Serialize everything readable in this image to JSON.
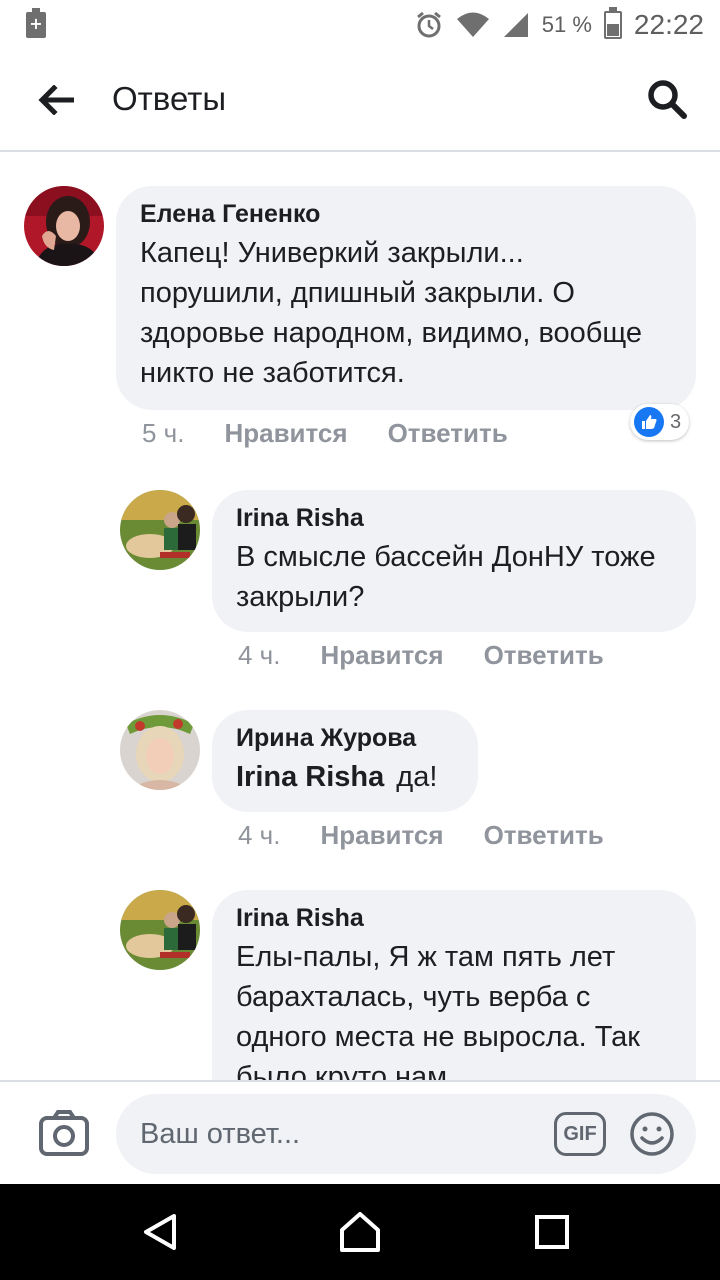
{
  "status_bar": {
    "left_icon": "battery-saver-icon",
    "left_glyph": "+",
    "icons": [
      "alarm-icon",
      "wifi-icon",
      "signal-icon"
    ],
    "battery_text": "51 %",
    "time": "22:22"
  },
  "app_bar": {
    "back_icon": "arrow-left-icon",
    "title": "Ответы",
    "search_icon": "search-icon"
  },
  "comments": [
    {
      "author": "Елена Гененко",
      "text": "Капец! Универкий закрыли... порушили, дпишный закрыли. О здоровье народном, видимо, вообще никто не заботится.",
      "time": "5 ч.",
      "like_label": "Нравится",
      "reply_label": "Ответить",
      "reactions": "3"
    },
    {
      "author": "Irina Risha",
      "text": "В смысле бассейн ДонНУ тоже закрыли?",
      "time": "4 ч.",
      "like_label": "Нравится",
      "reply_label": "Ответить"
    },
    {
      "author": "Ирина Журова",
      "mention": "Irina Risha",
      "text": "да!",
      "time": "4 ч.",
      "like_label": "Нравится",
      "reply_label": "Ответить"
    },
    {
      "author": "Irina Risha",
      "text": "Елы-палы, Я ж там пять лет барахталась, чуть верба с одного места не выросла. Так было круто нам"
    }
  ],
  "composer": {
    "camera_icon": "camera-icon",
    "placeholder": "Ваш ответ...",
    "gif_label": "GIF",
    "emoji_icon": "emoji-icon"
  },
  "nav_bar": {
    "icons": [
      "nav-back-icon",
      "nav-home-icon",
      "nav-recents-icon"
    ]
  },
  "colors": {
    "bubble": "#f0f2f5",
    "meta_text": "#90949c",
    "like_blue": "#1877f2",
    "divider": "#dadde1"
  }
}
